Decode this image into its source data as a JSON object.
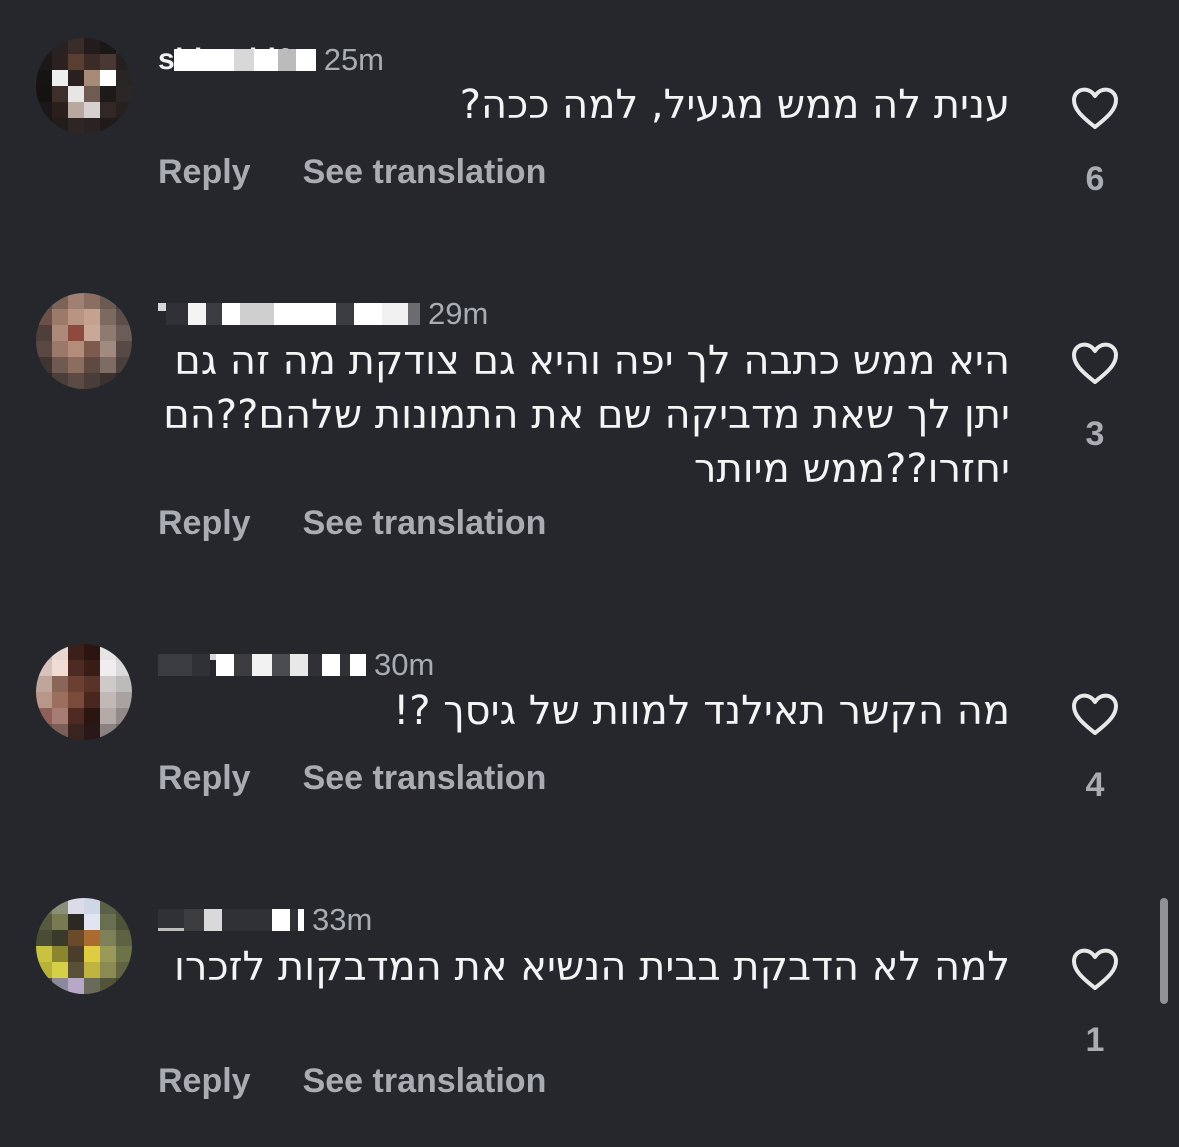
{
  "comments": [
    {
      "username": "shlombi6",
      "time": "25m",
      "text": "ענית לה ממש מגעיל, למה ככה?",
      "reply_label": "Reply",
      "translate_label": "See translation",
      "likes": "6"
    },
    {
      "username": "",
      "time": "29m",
      "text": "היא ממש כתבה לך יפה והיא גם צודקת מה זה גם יתן לך שאת מדביקה שם את התמונות שלהם??הם יחזרו??ממש מיותר",
      "reply_label": "Reply",
      "translate_label": "See translation",
      "likes": "3"
    },
    {
      "username": "",
      "time": "30m",
      "text": "מה הקשר תאילנד למוות של גיסך ?!",
      "reply_label": "Reply",
      "translate_label": "See translation",
      "likes": "4"
    },
    {
      "username": "",
      "time": "33m",
      "text": "למה לא הדבקת בבית הנשיא את המדבקות לזכרו",
      "reply_label": "Reply",
      "translate_label": "See translation",
      "likes": "1"
    }
  ],
  "icons": {
    "like": "heart-outline-icon"
  },
  "colors": {
    "background": "#25272c",
    "text": "#f4f4f4",
    "secondary": "#a9acb2"
  }
}
